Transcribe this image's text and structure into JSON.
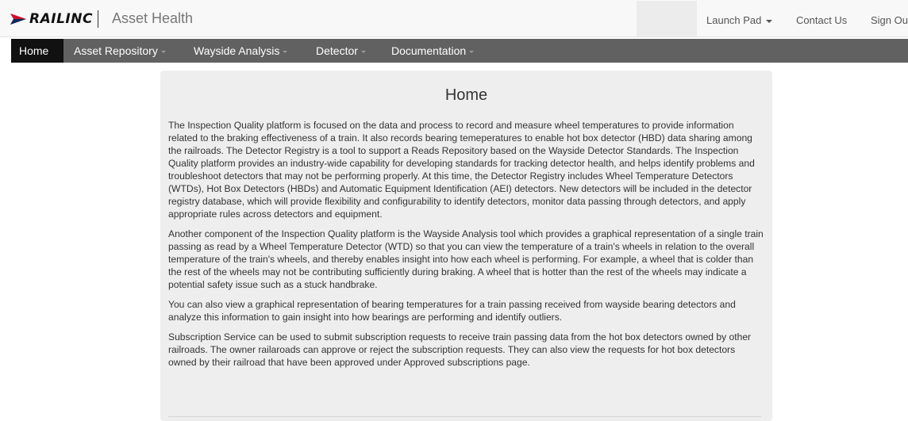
{
  "header": {
    "logo_text": "RAILINC",
    "app_title": "Asset Health",
    "links": {
      "launch_pad": "Launch Pad",
      "contact_us": "Contact Us",
      "sign_out": "Sign Out"
    }
  },
  "nav": {
    "items": [
      {
        "label": "Home",
        "active": true
      },
      {
        "label": "Asset Repository"
      },
      {
        "label": "Wayside Analysis"
      },
      {
        "label": "Detector"
      },
      {
        "label": "Documentation"
      }
    ]
  },
  "main": {
    "title": "Home",
    "paragraphs": [
      "The Inspection Quality platform is focused on the data and process to record and measure wheel temperatures to provide information related to the braking effectiveness of a train. It also records bearing temeperatures to enable hot box detector (HBD) data sharing among the railroads. The Detector Registry is a tool to support a Reads Repository based on the Wayside Detector Standards. The Inspection Quality platform provides an industry-wide capability for developing standards for tracking detector health, and helps identify problems and troubleshoot detectors that may not be performing properly. At this time, the Detector Registry includes Wheel Temperature Detectors (WTDs), Hot Box Detectors (HBDs) and Automatic Equipment Identification (AEI) detectors. New detectors will be included in the detector registry database, which will provide flexibility and configurability to identify detectors, monitor data passing through detectors, and apply appropriate rules across detectors and equipment.",
      "Another component of the Inspection Quality platform is the Wayside Analysis tool which provides a graphical representation of a single train passing as read by a Wheel Temperature Detector (WTD) so that you can view the temperature of a train's wheels in relation to the overall temperature of the train's wheels, and thereby enables insight into how each wheel is performing. For example, a wheel that is colder than the rest of the wheels may not be contributing sufficiently during braking. A wheel that is hotter than the rest of the wheels may indicate a potential safety issue such as a stuck handbrake.",
      "You can also view a graphical representation of bearing temperatures for a train passing received from wayside bearing detectors and analyze this information to gain insight into how bearings are performing and identify outliers.",
      "Subscription Service can be used to submit subscription requests to receive train passing data from the hot box detectors owned by other railroads. The owner railaroads can approve or reject the subscription requests. They can also view the requests for hot box detectors owned by their railroad that have been approved under Approved subscriptions page."
    ]
  }
}
